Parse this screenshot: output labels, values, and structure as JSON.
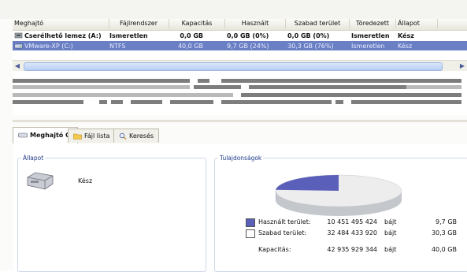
{
  "list": {
    "columns": [
      "Meghajtó",
      "Fájlrendszer",
      "Kapacitás",
      "Használt",
      "Szabad terület",
      "Töredezett",
      "Állapot"
    ],
    "rows": [
      {
        "name": "Cserélhető lemez (A:)",
        "fs": "Ismeretlen",
        "capacity": "0,0 GB",
        "used": "0,0 GB (0%)",
        "free": "0,0 GB (0%)",
        "frag": "Ismeretlen",
        "status": "Kész",
        "icon": "floppy-drive-icon",
        "selected": false
      },
      {
        "name": "VMware-XP (C:)",
        "fs": "NTFS",
        "capacity": "40,0 GB",
        "used": "9,7 GB (24%)",
        "free": "30,3 GB (76%)",
        "frag": "Ismeretlen",
        "status": "Kész",
        "icon": "hard-drive-icon",
        "selected": true
      }
    ]
  },
  "tabs": [
    {
      "label": "Meghajtó C:",
      "icon": "drive-icon",
      "active": true
    },
    {
      "label": "Fájl lista",
      "icon": "folder-icon",
      "active": false
    },
    {
      "label": "Keresés",
      "icon": "search-icon",
      "active": false
    }
  ],
  "status_panel": {
    "title": "Állapot",
    "status": "Kész",
    "icon": "hard-drive-icon"
  },
  "properties_panel": {
    "title": "Tulajdonságok",
    "used_percent": 24,
    "used_label": "Használt terület:",
    "used_bytes": "10 451 495 424",
    "used_gb": "9,7 GB",
    "free_label": "Szabad terület:",
    "free_bytes": "32 484 433 920",
    "free_gb": "30,3 GB",
    "capacity_label": "Kapacitás:",
    "capacity_bytes": "42 935 929 344",
    "capacity_gb": "40,0 GB",
    "unit": "bájt",
    "colors": {
      "used": "#5a5fba",
      "free": "#ffffff"
    }
  }
}
